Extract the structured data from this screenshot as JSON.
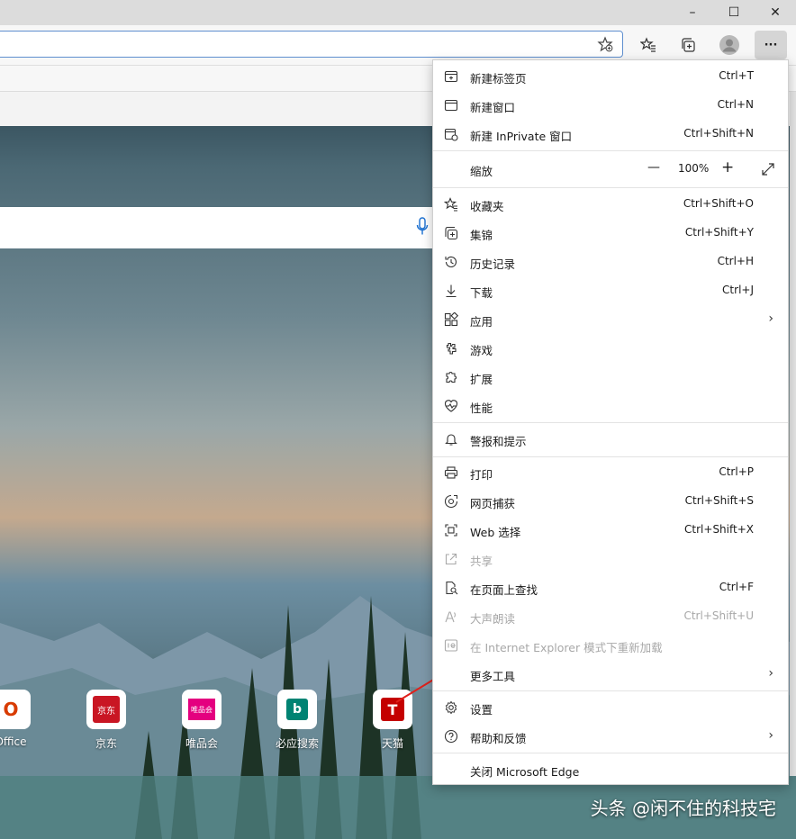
{
  "window": {
    "minimize_glyph": "–",
    "maximize_glyph": "☐",
    "close_glyph": "✕"
  },
  "toolbar": {
    "address_value": "",
    "more_glyph": "···"
  },
  "tiles": [
    {
      "label": "Office",
      "icon": "office-icon",
      "color": "#d83b01"
    },
    {
      "label": "京东",
      "icon": "jd-icon",
      "color": "#c91623",
      "badge": "京东"
    },
    {
      "label": "唯品会",
      "icon": "vip-icon",
      "color": "#e4007f",
      "badge": "唯品会"
    },
    {
      "label": "必应搜索",
      "icon": "bing-icon",
      "color": "#008373",
      "badge": "b"
    },
    {
      "label": "天猫",
      "icon": "tmall-icon",
      "color": "#c40000",
      "badge": "T"
    }
  ],
  "menu": {
    "new_tab": {
      "label": "新建标签页",
      "shortcut": "Ctrl+T"
    },
    "new_window": {
      "label": "新建窗口",
      "shortcut": "Ctrl+N"
    },
    "new_inprivate": {
      "label": "新建 InPrivate 窗口",
      "shortcut": "Ctrl+Shift+N"
    },
    "zoom": {
      "label": "缩放",
      "minus": "—",
      "value": "100%",
      "plus": "+"
    },
    "favorites": {
      "label": "收藏夹",
      "shortcut": "Ctrl+Shift+O"
    },
    "collections": {
      "label": "集锦",
      "shortcut": "Ctrl+Shift+Y"
    },
    "history": {
      "label": "历史记录",
      "shortcut": "Ctrl+H"
    },
    "downloads": {
      "label": "下载",
      "shortcut": "Ctrl+J"
    },
    "apps": {
      "label": "应用"
    },
    "games": {
      "label": "游戏"
    },
    "extensions": {
      "label": "扩展"
    },
    "performance": {
      "label": "性能"
    },
    "alerts": {
      "label": "警报和提示"
    },
    "print": {
      "label": "打印",
      "shortcut": "Ctrl+P"
    },
    "web_capture": {
      "label": "网页捕获",
      "shortcut": "Ctrl+Shift+S"
    },
    "web_select": {
      "label": "Web 选择",
      "shortcut": "Ctrl+Shift+X"
    },
    "share": {
      "label": "共享"
    },
    "find": {
      "label": "在页面上查找",
      "shortcut": "Ctrl+F"
    },
    "read_aloud": {
      "label": "大声朗读",
      "shortcut": "Ctrl+Shift+U"
    },
    "ie_mode": {
      "label": "在 Internet Explorer 模式下重新加载"
    },
    "more_tools": {
      "label": "更多工具"
    },
    "settings": {
      "label": "设置"
    },
    "help": {
      "label": "帮助和反馈"
    },
    "close_edge": {
      "label": "关闭 Microsoft Edge"
    }
  },
  "watermark": "头条 @闲不住的科技宅",
  "colors": {
    "accent": "#0067c0",
    "arrow": "#e0201b",
    "disabled": "#a8a8a8"
  }
}
